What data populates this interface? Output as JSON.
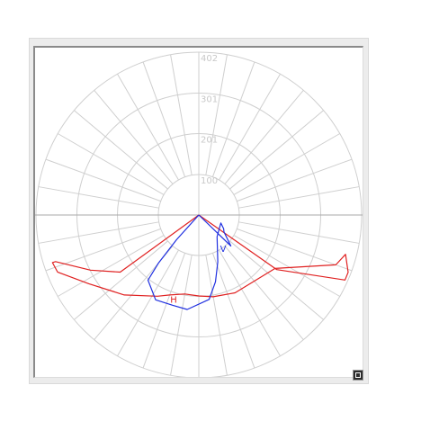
{
  "chart_data": {
    "type": "polar",
    "ring_labels": [
      "100",
      "201",
      "301",
      "402"
    ],
    "ring_values": [
      100,
      201,
      301,
      402
    ],
    "r_max": 402,
    "angle_step_deg": 10,
    "grid": true,
    "series": [
      {
        "name": "H",
        "color": "#e02020",
        "points": [
          {
            "angle": 0,
            "r": 0
          },
          {
            "angle": 55,
            "r": 235
          },
          {
            "angle": 66,
            "r": 395
          },
          {
            "angle": 69,
            "r": 395
          },
          {
            "angle": 75,
            "r": 375
          },
          {
            "angle": 70,
            "r": 360
          },
          {
            "angle": 55,
            "r": 230
          },
          {
            "angle": 25,
            "r": 212
          },
          {
            "angle": 10,
            "r": 205
          },
          {
            "angle": 0,
            "r": 200
          },
          {
            "angle": -10,
            "r": 198
          },
          {
            "angle": -20,
            "r": 210
          },
          {
            "angle": -27,
            "r": 225
          },
          {
            "angle": -43,
            "r": 270
          },
          {
            "angle": -58,
            "r": 320
          },
          {
            "angle": -68,
            "r": 376
          },
          {
            "angle": -72,
            "r": 380
          },
          {
            "angle": -72,
            "r": 372
          },
          {
            "angle": -63,
            "r": 300
          },
          {
            "angle": -54,
            "r": 240
          },
          {
            "angle": 0,
            "r": 0
          }
        ]
      },
      {
        "name": "V",
        "color": "#2030e0",
        "points": [
          {
            "angle": 0,
            "r": 0
          },
          {
            "angle": 46,
            "r": 110
          },
          {
            "angle": 56,
            "r": 75
          },
          {
            "angle": 61,
            "r": 70
          },
          {
            "angle": 70,
            "r": 58
          },
          {
            "angle": 40,
            "r": 70
          },
          {
            "angle": 22,
            "r": 125
          },
          {
            "angle": 14,
            "r": 170
          },
          {
            "angle": 7,
            "r": 210
          },
          {
            "angle": -7,
            "r": 235
          },
          {
            "angle": -16,
            "r": 232
          },
          {
            "angle": -27,
            "r": 235
          },
          {
            "angle": -38,
            "r": 204
          },
          {
            "angle": -40,
            "r": 154
          },
          {
            "angle": -42,
            "r": 82
          },
          {
            "angle": 0,
            "r": 0
          }
        ]
      }
    ],
    "curve_labels": [
      {
        "text": "H",
        "angle": -18,
        "r": 228
      },
      {
        "text": "V",
        "angle": 30,
        "r": 105
      }
    ]
  },
  "toolbar": {
    "corner_icon": "copy-icon"
  }
}
